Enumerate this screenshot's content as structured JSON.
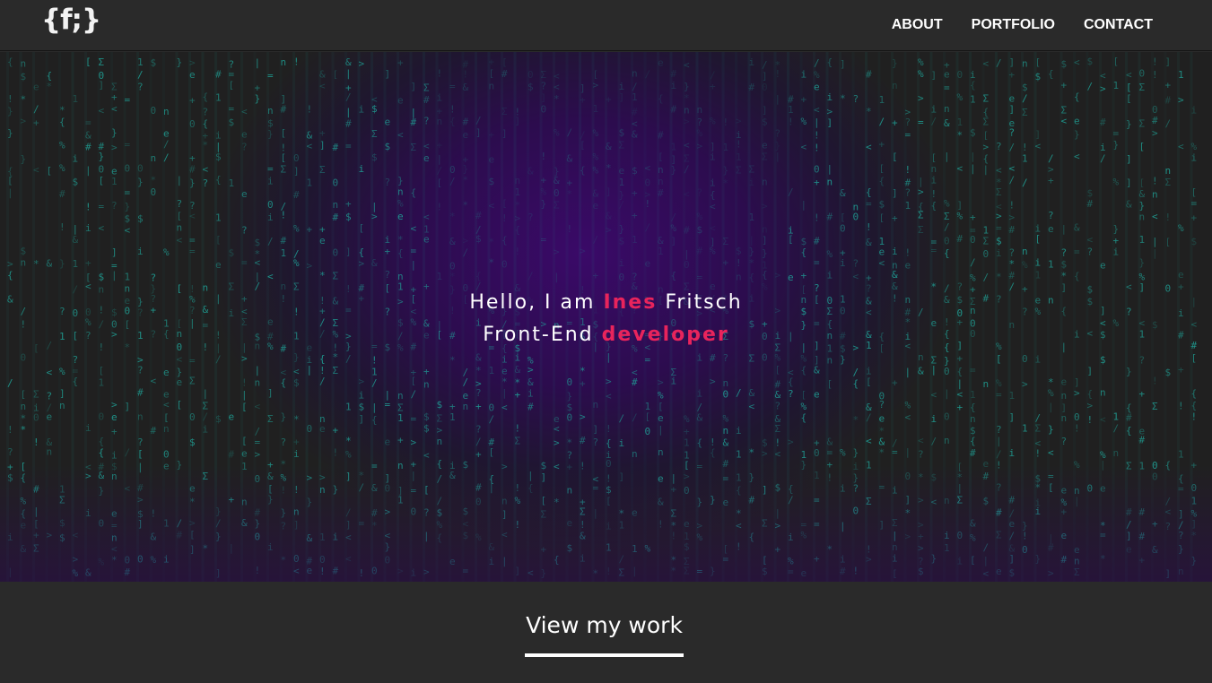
{
  "brand": {
    "logo_text": "{f;}"
  },
  "nav": {
    "items": [
      {
        "label": "ABOUT"
      },
      {
        "label": "PORTFOLIO"
      },
      {
        "label": "CONTACT"
      }
    ]
  },
  "hero": {
    "line1_prefix": "Hello, I am ",
    "line1_highlight": "Ines",
    "line1_suffix": " Fritsch",
    "line2_prefix": "Front-End ",
    "line2_highlight": "developer",
    "rain_glyphs": "$ > n < 0 1 ! / e % { } [ ] Σ & # ? = + * i |"
  },
  "cta": {
    "label": "View my work"
  },
  "colors": {
    "accent": "#e8245c",
    "rain": "#1fa89c",
    "background": "#2a2a2a",
    "glow": "#3a0a68"
  }
}
